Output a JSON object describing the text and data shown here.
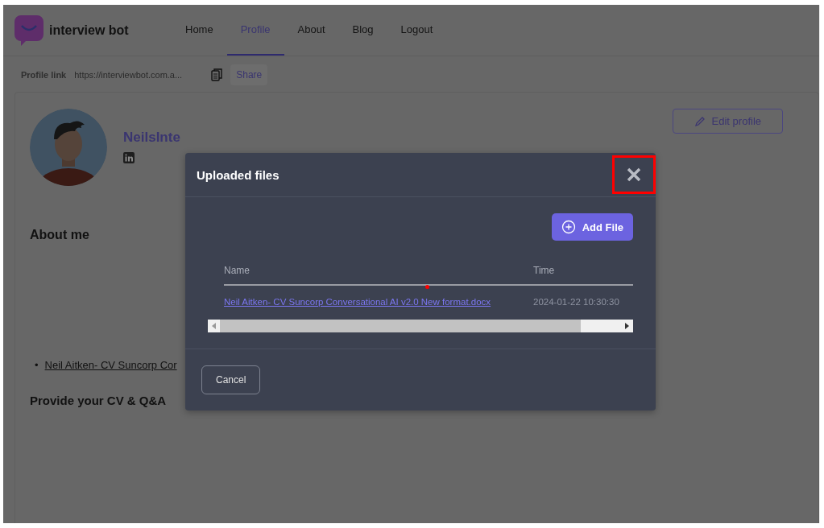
{
  "brand": {
    "name": "interview bot"
  },
  "nav": [
    {
      "label": "Home",
      "selected": false
    },
    {
      "label": "Profile",
      "selected": true
    },
    {
      "label": "About",
      "selected": false
    },
    {
      "label": "Blog",
      "selected": false
    },
    {
      "label": "Logout",
      "selected": false
    }
  ],
  "profile_link": {
    "label": "Profile link",
    "url": "https://interviewbot.com.a...",
    "share": "Share"
  },
  "profile": {
    "name": "NeilsInte",
    "edit": "Edit profile",
    "about_heading": "About me",
    "files": [
      {
        "bullet": "•",
        "name": "Neil Aitken- CV Suncorp Cor"
      }
    ],
    "cv_heading": "Provide your CV & Q&A"
  },
  "modal": {
    "title": "Uploaded files",
    "add_button": "Add File",
    "columns": [
      "Name",
      "Time"
    ],
    "rows": [
      {
        "name": "Neil Aitken- CV Suncorp Conversational AI v2.0 New format.docx",
        "time": "2024-01-22 10:30:30"
      }
    ],
    "cancel": "Cancel"
  }
}
